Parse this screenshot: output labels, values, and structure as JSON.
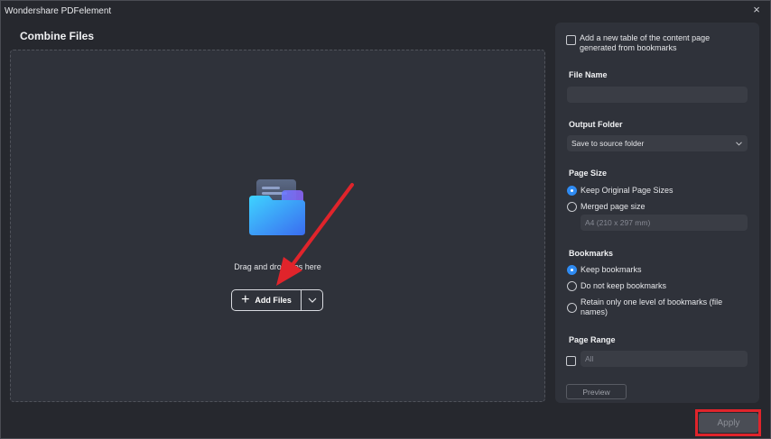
{
  "window": {
    "title": "Wondershare PDFelement",
    "close_glyph": "×"
  },
  "main": {
    "title": "Combine Files",
    "drag_text": "Drag and drop files here",
    "add_files_label": "Add Files",
    "folder_icon": "folder-icon"
  },
  "side": {
    "toc_checkbox_label": "Add a new table of the content page generated from bookmarks",
    "toc_checked": false,
    "file_name": {
      "label": "File Name",
      "value": ""
    },
    "output_folder": {
      "label": "Output Folder",
      "value": "Save to source folder"
    },
    "page_size": {
      "label": "Page Size",
      "options": [
        "Keep Original Page Sizes",
        "Merged page size"
      ],
      "selected": 0,
      "size_value": "A4 (210 x 297 mm)"
    },
    "bookmarks": {
      "label": "Bookmarks",
      "options": [
        "Keep bookmarks",
        "Do not keep bookmarks",
        "Retain only one level of bookmarks (file names)"
      ],
      "selected": 0
    },
    "page_range": {
      "label": "Page Range",
      "value": "All",
      "checked": false
    },
    "preview_label": "Preview"
  },
  "footer": {
    "apply_label": "Apply"
  },
  "colors": {
    "accent": "#2f8bf2",
    "annotation_red": "#e0242b"
  }
}
